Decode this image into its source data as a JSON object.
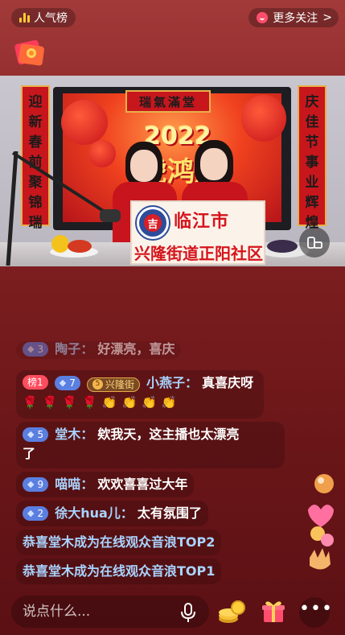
{
  "topbar": {
    "rank_label": "人气榜",
    "follow_label": "更多关注",
    "follow_chevron": ">"
  },
  "video": {
    "couplet_left": [
      "迎",
      "新",
      "春",
      "前",
      "聚",
      "锦",
      "瑞"
    ],
    "couplet_right": [
      "庆",
      "佳",
      "节",
      "事",
      "业",
      "辉",
      "煌"
    ],
    "banner": "瑞氣滿堂",
    "year": "2022",
    "slogan": "虎鸿运",
    "sign_city": "临江市",
    "sign_community": "兴隆街道正阳社区",
    "sign_logo_char": "吉"
  },
  "chat": {
    "partial": {
      "badge": "3",
      "name": "陶子：",
      "text": "好漂亮，喜庆"
    },
    "msg1": {
      "rank_badge": "榜1",
      "level_badge": "7",
      "club_num": "5",
      "club_badge": "兴隆街",
      "name": "小燕子：",
      "text": "真喜庆呀"
    },
    "msg1_emojis": [
      "🌹",
      "🌹",
      "🌹",
      "🌹",
      "👏",
      "👏",
      "👏",
      "👏"
    ],
    "msg2": {
      "level_badge": "5",
      "name": "堂木：",
      "text": "欸我天，这主播也太漂亮",
      "text2": "了"
    },
    "msg3": {
      "level_badge": "9",
      "name": "喵喵：",
      "text": "欢欢喜喜过大年"
    },
    "msg4": {
      "level_badge": "2",
      "name": "徐大hua儿：",
      "text": "太有氛围了"
    },
    "sys1": "恭喜堂木成为在线观众音浪TOP2",
    "sys2": "恭喜堂木成为在线观众音浪TOP1"
  },
  "bottombar": {
    "input_placeholder": "说点什么...",
    "more_label": "•••"
  },
  "icons": {
    "rank": "bar-chart-icon",
    "follow": "follow-icon",
    "gift_badge": "red-envelope-icon",
    "orientation": "rotate-screen-icon",
    "mic": "microphone-icon",
    "coins": "coins-icon",
    "gift": "gift-box-icon",
    "more": "more-dots-icon"
  },
  "colors": {
    "background": "#7a1d1f",
    "username": "#a9d4ff",
    "level_badge": "#5a7fe0",
    "rank_badge": "#ff4d5e",
    "gift": "#ff4d6d"
  }
}
